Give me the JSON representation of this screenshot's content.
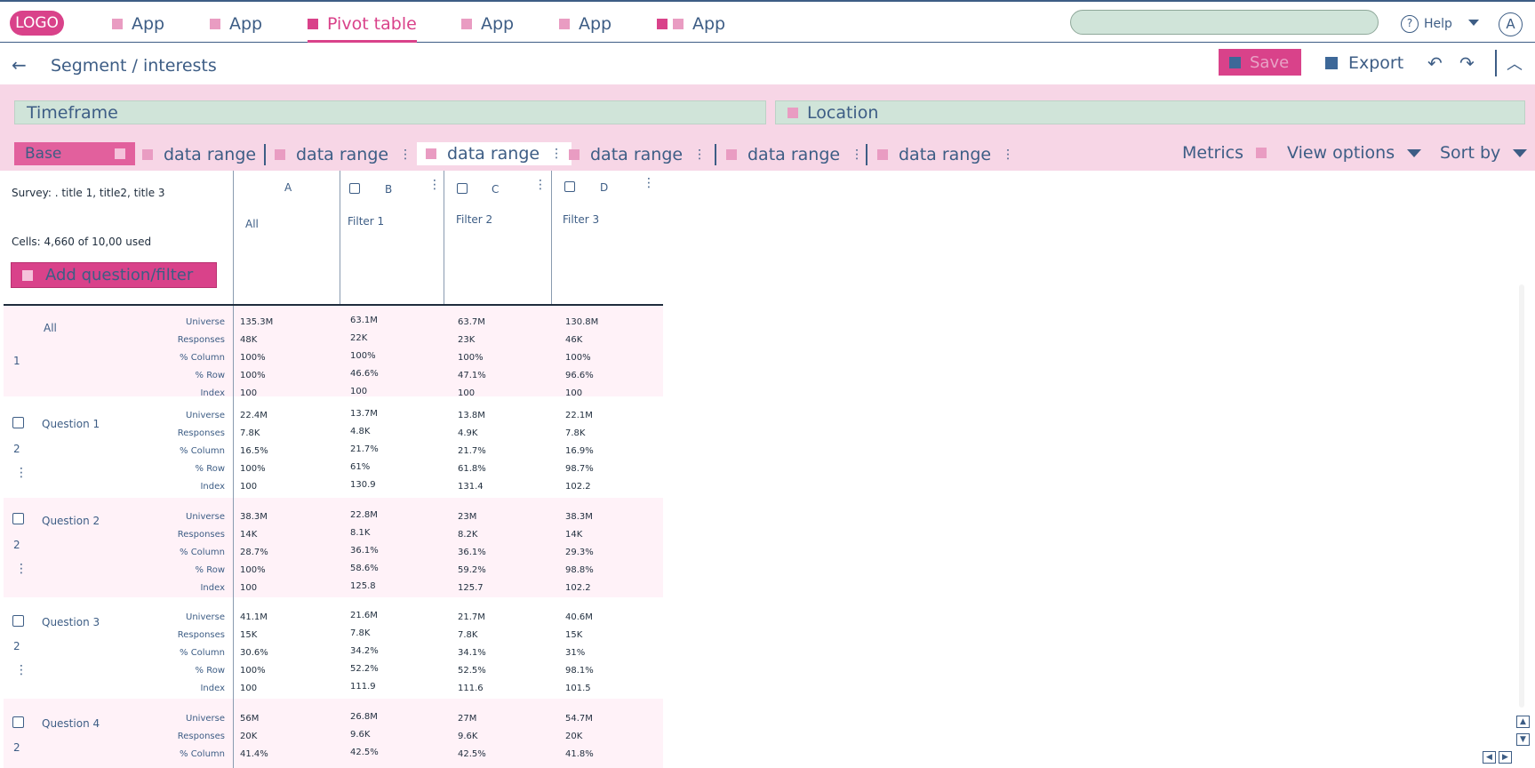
{
  "nav": {
    "logo": "LOGO",
    "items": [
      {
        "label": "App",
        "active": false
      },
      {
        "label": "App",
        "active": false
      },
      {
        "label": "Pivot table",
        "active": true
      },
      {
        "label": "App",
        "active": false
      },
      {
        "label": "App",
        "active": false
      },
      {
        "label": "App",
        "active": false
      }
    ],
    "help": "Help",
    "avatar": "A"
  },
  "subbar": {
    "breadcrumb": "Segment / interests",
    "save": "Save",
    "export": "Export"
  },
  "filters": {
    "timeframe": "Timeframe",
    "location": "Location"
  },
  "tabs": {
    "base": "Base",
    "data_ranges": [
      "data range",
      "data range",
      "data range",
      "data range",
      "data range",
      "data range"
    ],
    "metrics": "Metrics",
    "view_options": "View options",
    "sort_by": "Sort by"
  },
  "table": {
    "survey": "Survey: . title 1, title2, title 3",
    "cells": "Cells: 4,660 of 10,00 used",
    "add_button": "Add question/filter",
    "columns": [
      {
        "letter": "A",
        "name": "All"
      },
      {
        "letter": "B",
        "name": "Filter 1"
      },
      {
        "letter": "C",
        "name": "Filter 2"
      },
      {
        "letter": "D",
        "name": "Filter 3"
      }
    ],
    "metrics": [
      "Universe",
      "Responses",
      "% Column",
      "% Row",
      "Index"
    ],
    "rows": [
      {
        "label": "All",
        "num": "1",
        "values": [
          [
            "135.3M",
            "48K",
            "100%",
            "100%",
            "100"
          ],
          [
            "63.1M",
            "22K",
            "100%",
            "46.6%",
            "100"
          ],
          [
            "63.7M",
            "23K",
            "100%",
            "47.1%",
            "100"
          ],
          [
            "130.8M",
            "46K",
            "100%",
            "96.6%",
            "100"
          ]
        ]
      },
      {
        "label": "Question 1",
        "num": "2",
        "values": [
          [
            "22.4M",
            "7.8K",
            "16.5%",
            "100%",
            "100"
          ],
          [
            "13.7M",
            "4.8K",
            "21.7%",
            "61%",
            "130.9"
          ],
          [
            "13.8M",
            "4.9K",
            "21.7%",
            "61.8%",
            "131.4"
          ],
          [
            "22.1M",
            "7.8K",
            "16.9%",
            "98.7%",
            "102.2"
          ]
        ]
      },
      {
        "label": "Question 2",
        "num": "2",
        "values": [
          [
            "38.3M",
            "14K",
            "28.7%",
            "100%",
            "100"
          ],
          [
            "22.8M",
            "8.1K",
            "36.1%",
            "58.6%",
            "125.8"
          ],
          [
            "23M",
            "8.2K",
            "36.1%",
            "59.2%",
            "125.7"
          ],
          [
            "38.3M",
            "14K",
            "29.3%",
            "98.8%",
            "102.2"
          ]
        ]
      },
      {
        "label": "Question 3",
        "num": "2",
        "values": [
          [
            "41.1M",
            "15K",
            "30.6%",
            "100%",
            "100"
          ],
          [
            "21.6M",
            "7.8K",
            "34.2%",
            "52.2%",
            "111.9"
          ],
          [
            "21.7M",
            "7.8K",
            "34.1%",
            "52.5%",
            "111.6"
          ],
          [
            "40.6M",
            "15K",
            "31%",
            "98.1%",
            "101.5"
          ]
        ]
      },
      {
        "label": "Question 4",
        "num": "2",
        "values": [
          [
            "56M",
            "20K",
            "41.4%"
          ],
          [
            "26.8M",
            "9.6K",
            "42.5%"
          ],
          [
            "27M",
            "9.6K",
            "42.5%"
          ],
          [
            "54.7M",
            "20K",
            "41.8%"
          ]
        ]
      }
    ]
  }
}
